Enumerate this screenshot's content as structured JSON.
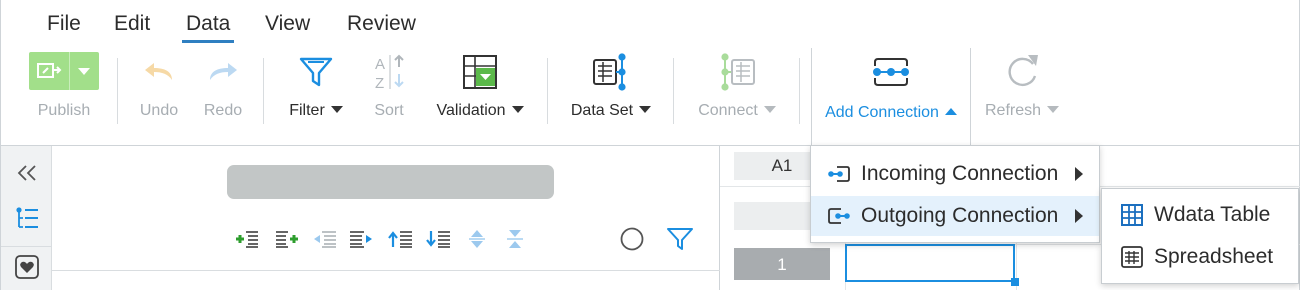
{
  "menubar": {
    "items": [
      {
        "label": "File"
      },
      {
        "label": "Edit"
      },
      {
        "label": "Data",
        "active": true
      },
      {
        "label": "View"
      },
      {
        "label": "Review"
      }
    ]
  },
  "toolbar": {
    "publish": {
      "label": "Publish",
      "enabled": false,
      "icon": "publish-icon"
    },
    "undo": {
      "label": "Undo",
      "enabled": false,
      "icon": "undo-icon"
    },
    "redo": {
      "label": "Redo",
      "enabled": false,
      "icon": "redo-icon"
    },
    "filter": {
      "label": "Filter",
      "enabled": true,
      "icon": "filter-icon"
    },
    "sort": {
      "label": "Sort",
      "enabled": false,
      "icon": "sort-az-icon"
    },
    "validation": {
      "label": "Validation",
      "enabled": true,
      "icon": "validation-icon"
    },
    "dataset": {
      "label": "Data Set",
      "enabled": true,
      "icon": "data-set-icon"
    },
    "connect": {
      "label": "Connect",
      "enabled": false,
      "icon": "connect-icon"
    },
    "add_connection": {
      "label": "Add Connection",
      "enabled": true,
      "open": true,
      "icon": "add-connection-icon"
    },
    "refresh": {
      "label": "Refresh",
      "enabled": false,
      "icon": "refresh-icon"
    }
  },
  "add_connection_menu": {
    "items": [
      {
        "label": "Incoming Connection",
        "icon": "incoming-connection-icon",
        "has_submenu": true
      },
      {
        "label": "Outgoing Connection",
        "icon": "outgoing-connection-icon",
        "has_submenu": true,
        "highlighted": true
      }
    ]
  },
  "outgoing_submenu": {
    "items": [
      {
        "label": "Wdata Table",
        "icon": "table-icon"
      },
      {
        "label": "Spreadsheet",
        "icon": "spreadsheet-icon"
      }
    ]
  },
  "grid": {
    "cell_ref": "A1",
    "row_number": "1"
  },
  "colors": {
    "accent": "#1b8ee0",
    "publish_green": "#a2df8a",
    "disabled_text": "#a7adb2"
  }
}
